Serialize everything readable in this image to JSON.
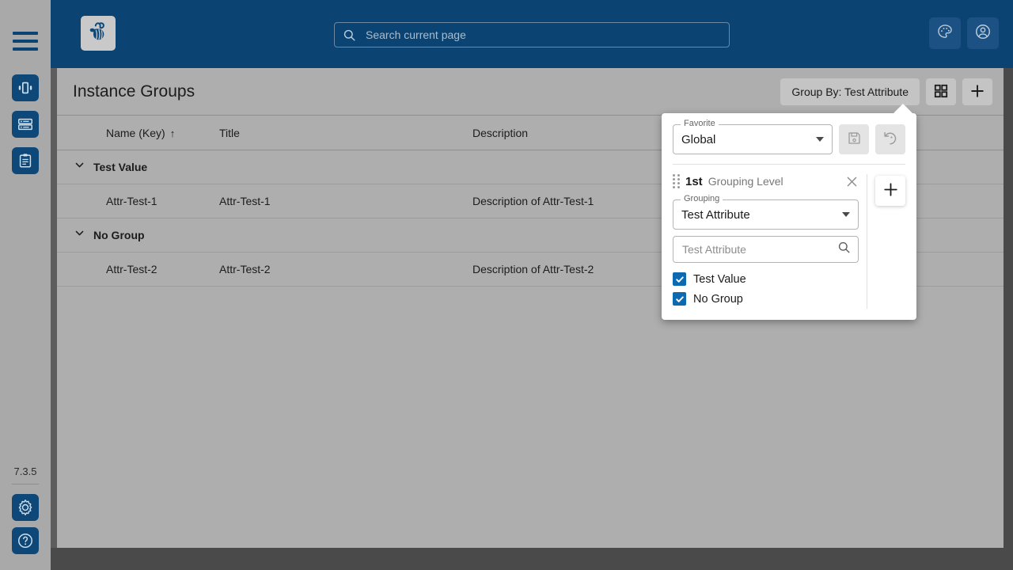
{
  "app": {
    "version": "7.3.5",
    "logo_icon": "bee-logo-icon",
    "menu_icon": "hamburger-menu-icon"
  },
  "rail": {
    "items": [
      {
        "icon": "instances-icon",
        "name": "sidebar-item-instances"
      },
      {
        "icon": "instance-groups-list-icon",
        "name": "sidebar-item-instance-groups"
      },
      {
        "icon": "clipboard-reports-icon",
        "name": "sidebar-item-reports"
      }
    ],
    "bottom": [
      {
        "icon": "gear-settings-icon",
        "name": "sidebar-item-settings"
      },
      {
        "icon": "help-question-icon",
        "name": "sidebar-item-help"
      }
    ]
  },
  "search": {
    "placeholder": "Search current page",
    "value": "",
    "icon": "search-icon"
  },
  "topright": [
    {
      "icon": "theme-palette-icon",
      "name": "theme-button"
    },
    {
      "icon": "user-account-icon",
      "name": "account-button"
    }
  ],
  "header": {
    "title": "Instance Groups",
    "group_by_label": "Group By: Test Attribute",
    "grid_view_icon": "grid-view-icon",
    "add_icon": "plus-add-icon"
  },
  "table": {
    "columns": [
      {
        "label": "Name (Key)",
        "sort": "↑"
      },
      {
        "label": "Title",
        "sort": ""
      },
      {
        "label": "Description",
        "sort": ""
      }
    ],
    "groups": [
      {
        "label": "Test Value",
        "chevron": "⌄",
        "rows": [
          {
            "name": "Attr-Test-1",
            "title": "Attr-Test-1",
            "description": "Description of Attr-Test-1"
          }
        ]
      },
      {
        "label": "No Group",
        "chevron": "⌄",
        "rows": [
          {
            "name": "Attr-Test-2",
            "title": "Attr-Test-2",
            "description": "Description of Attr-Test-2"
          }
        ]
      }
    ]
  },
  "popover": {
    "favorite": {
      "legend": "Favorite",
      "value": "Global",
      "save_icon": "save-floppy-icon",
      "reset_icon": "reset-undo-icon"
    },
    "level": {
      "number": "1st",
      "label": "Grouping Level",
      "drag_icon": "drag-handle-icon",
      "close_icon": "close-x-icon",
      "grouping": {
        "legend": "Grouping",
        "value": "Test Attribute"
      },
      "filter": {
        "placeholder": "Test Attribute",
        "value": "",
        "icon": "search-icon"
      },
      "options": [
        {
          "label": "Test Value",
          "checked": true
        },
        {
          "label": "No Group",
          "checked": true
        }
      ]
    },
    "add_level_icon": "plus-add-icon"
  },
  "colors": {
    "brand_blue": "#0b4372",
    "rail_bg": "#a9a9a9",
    "content_bg": "#aeaeae",
    "checkbox_blue": "#0d6ab0",
    "desktop_bg": "#4a4a4a"
  }
}
